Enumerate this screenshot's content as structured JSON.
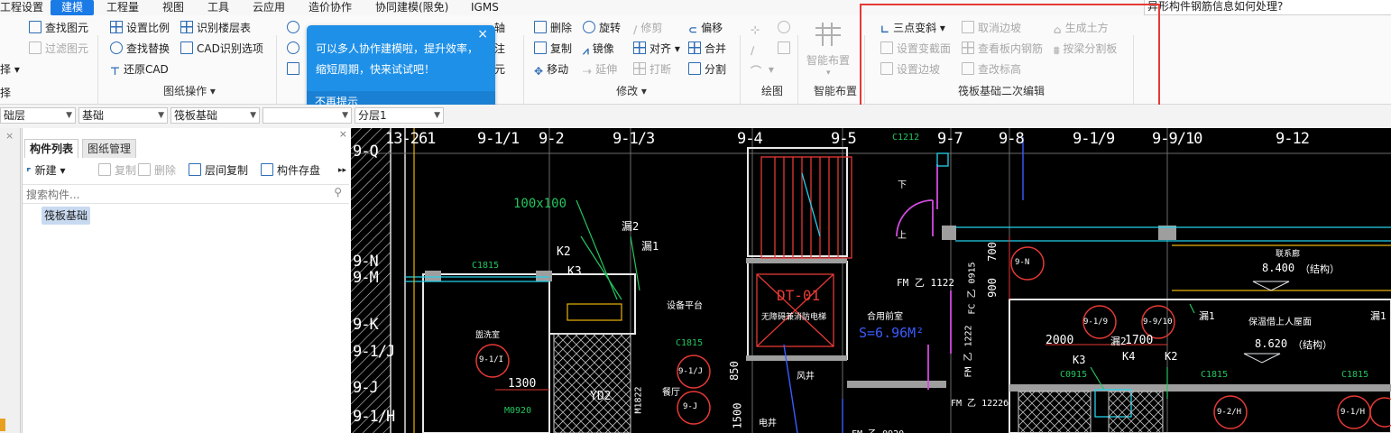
{
  "menu": {
    "items": [
      "工程设置",
      "建模",
      "工程量",
      "视图",
      "工具",
      "云应用",
      "造价协作",
      "协同建模(限免)",
      "IGMS"
    ],
    "active_index": 1,
    "help_search": "异形构件钢筋信息如何处理?"
  },
  "ribbon": {
    "col0": {
      "select": "择",
      "select2": "择"
    },
    "col1": {
      "find_element": "查找图元",
      "filter_element": "过滤图元"
    },
    "col2": {
      "set_scale": "设置比例",
      "find_replace": "查找替换",
      "restore_cad": "还原CAD",
      "identify_floor_table": "识别楼层表",
      "cad_identify_options": "CAD识别选项",
      "group_label": "图纸操作"
    },
    "col3_partial": {
      "axis": "轴",
      "annotate": "注",
      "yuan": "元"
    },
    "col4": {
      "delete": "删除",
      "rotate": "旋转",
      "trim": "修剪",
      "offset": "偏移",
      "copy": "复制",
      "mirror": "镜像",
      "align": "对齐",
      "merge": "合并",
      "move": "移动",
      "extend": "延伸",
      "break": "打断",
      "split": "分割",
      "group_label": "修改"
    },
    "draw": {
      "group_label": "绘图"
    },
    "smart": {
      "smart_layout": "智能布置",
      "group_label": "智能布置"
    },
    "raft": {
      "three_point_slope": "三点变斜",
      "set_variable_section": "设置变截面",
      "set_edge_slope": "设置边坡",
      "cancel_edge_slope": "取消边坡",
      "view_slab_rebar": "查看板内钢筋",
      "change_elevation": "查改标高",
      "generate_earthwork": "生成土方",
      "by_beam_split": "按梁分割板",
      "group_label": "筏板基础二次编辑"
    }
  },
  "tooltip": {
    "text": "可以多人协作建模啦，提升效率，缩短周期，快来试试吧！",
    "dismiss": "不再提示",
    "close": "×"
  },
  "selectors": {
    "layer": "础层",
    "category": "基础",
    "type": "筏板基础",
    "item": "",
    "sublayer": "分层1"
  },
  "component_panel": {
    "tabs": [
      "构件列表",
      "图纸管理"
    ],
    "toolbar": {
      "new": "新建",
      "copy": "复制",
      "delete": "删除",
      "floor_copy": "层间复制",
      "save": "构件存盘"
    },
    "search_placeholder": "搜索构件...",
    "items": [
      "筏板基础"
    ]
  },
  "cad": {
    "axis_top": [
      "13-261",
      "9-1/1",
      "9-2",
      "9-1/3",
      "9-4",
      "9-5",
      "9-7",
      "9-8",
      "9-1/9",
      "9-9/10",
      "9-12"
    ],
    "axis_left": [
      "9-Q",
      "9-N",
      "9-M",
      "9-K",
      "9-1/J",
      "9-J",
      "9-1/H"
    ],
    "labels": {
      "dim_100x100": "100x100",
      "lou2": "漏2",
      "lou1": "漏1",
      "k2": "K2",
      "k3": "K3",
      "k4": "K4",
      "c1815": "C1815",
      "c1212": "C1212",
      "c0915": "C0915",
      "dt01": "DT-01",
      "dt01_desc": "无障碍兼消防电梯",
      "hall": "合用前室",
      "area": "S=6.96M²",
      "fm1122": "FM 乙 1122",
      "fc0915": "FC 乙 0915",
      "fm1222": "FM 乙 1222",
      "fm1222b": "FM 乙 1222б",
      "elev1": "8.400",
      "elev1_note": "（结构）",
      "elev2": "8.620",
      "elev2_note": "（结构）",
      "room_a": "联系廊",
      "room_b": "保温借上人屋面",
      "wc": "盥洗室",
      "dim_2000": "2000",
      "dim_1700": "1700",
      "dim_1300": "1300",
      "dim_700": "700",
      "dim_900": "900",
      "dim_850": "850",
      "dim_1500": "1500",
      "down": "下",
      "up": "上",
      "shaft": "风井",
      "hall2": "餐厅",
      "elec": "电井",
      "m0920": "M0920",
      "m1822": "M1822",
      "fm0920": "FM 乙 0920",
      "yd2": "YD2",
      "device": "设备平台",
      "bubble_9n": "9-N",
      "bubble_91_9": "9-1/9",
      "bubble_9_9_10": "9-9/10",
      "bubble_91_i": "9-1/I",
      "bubble_91_j": "9-1/J",
      "bubble_9j": "9-J",
      "bubble_92h": "9-2/H",
      "bubble_91h": "9-1/H"
    }
  },
  "colors": {
    "accent": "#1a7ae6",
    "tooltip": "#1e90e8",
    "highlight": "#e53935",
    "canvas": "#000000"
  }
}
